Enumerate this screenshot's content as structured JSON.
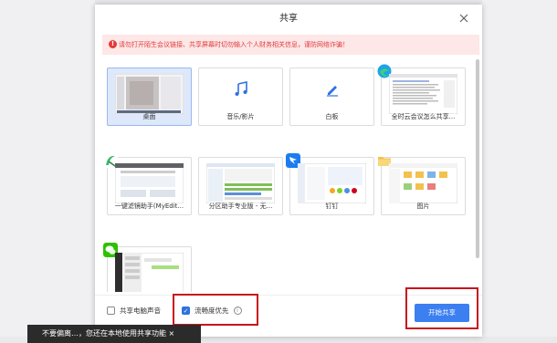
{
  "dialog": {
    "title": "共享",
    "warning": "请勿打开陌生会议链接、共享屏幕时切勿输入个人财务相关信息，谨防网络诈骗！"
  },
  "tiles": [
    {
      "label": "桌面",
      "icon": "desktop-thumbnail",
      "selected": true
    },
    {
      "label": "音乐/影片",
      "icon": "music-note-icon",
      "selected": false
    },
    {
      "label": "白板",
      "icon": "pen-icon",
      "selected": false
    },
    {
      "label": "全时云会议怎么共享...",
      "icon": "edge-browser-icon",
      "selected": false
    },
    {
      "label": "一键滤镜助手(MyEdit...",
      "icon": "myedit-app-icon",
      "selected": false
    },
    {
      "label": "分区助手专业版 - 无...",
      "icon": "partition-app-icon",
      "selected": false
    },
    {
      "label": "钉钉",
      "icon": "dingtalk-icon",
      "selected": false
    },
    {
      "label": "图片",
      "icon": "folder-icon",
      "selected": false
    },
    {
      "label": "",
      "icon": "wechat-icon",
      "selected": false
    }
  ],
  "footer": {
    "share_audio_label": "共享电脑声音",
    "share_audio_checked": false,
    "smooth_label": "流畅度优先",
    "smooth_checked": true,
    "start_label": "开始共享"
  },
  "toast": "不要偏离…，您还在本地使用共享功能 ×",
  "colors": {
    "accent": "#3c7ff0",
    "warning_text": "#e23b3b",
    "warning_bg": "#fde7e7",
    "highlight_box": "#c8141e"
  }
}
